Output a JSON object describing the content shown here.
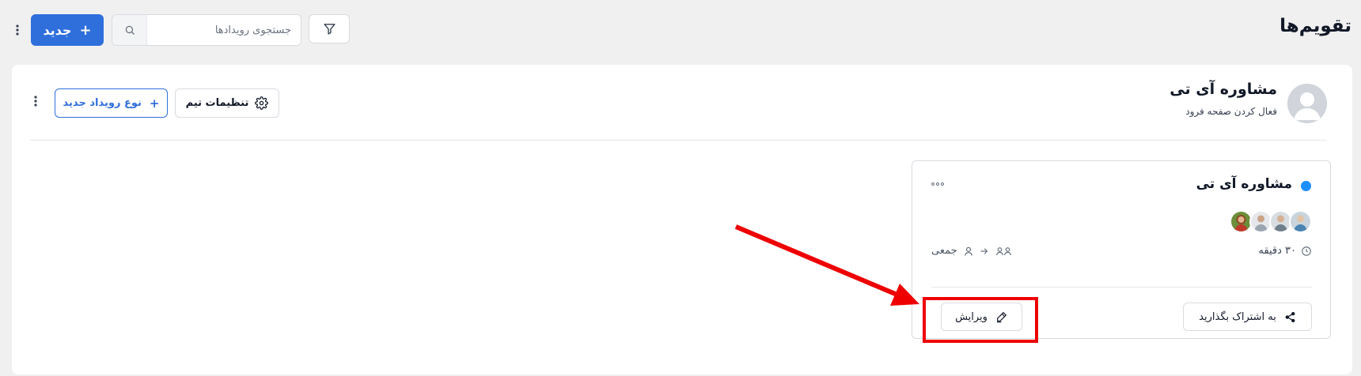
{
  "header": {
    "title": "تقویم‌ها",
    "new_button_label": "جدید",
    "search_placeholder": "جستجوی رویدادها"
  },
  "team": {
    "name": "مشاوره آی تی",
    "subtitle": "فعال کردن صفحه فرود",
    "settings_label": "تنظیمات تیم",
    "new_event_type_label": "نوع رویداد جدید"
  },
  "event_card": {
    "title": "مشاوره آی تی",
    "dot_color": "#1e90ff",
    "duration": "۳۰ دقیقه",
    "seats_type": "جمعی",
    "share_label": "به اشتراک بگذارید",
    "edit_label": "ویرایش",
    "hosts": [
      "host-1",
      "host-2",
      "host-3",
      "host-4"
    ]
  },
  "colors": {
    "primary": "#2f6fdc",
    "annotation": "#ee0000"
  }
}
